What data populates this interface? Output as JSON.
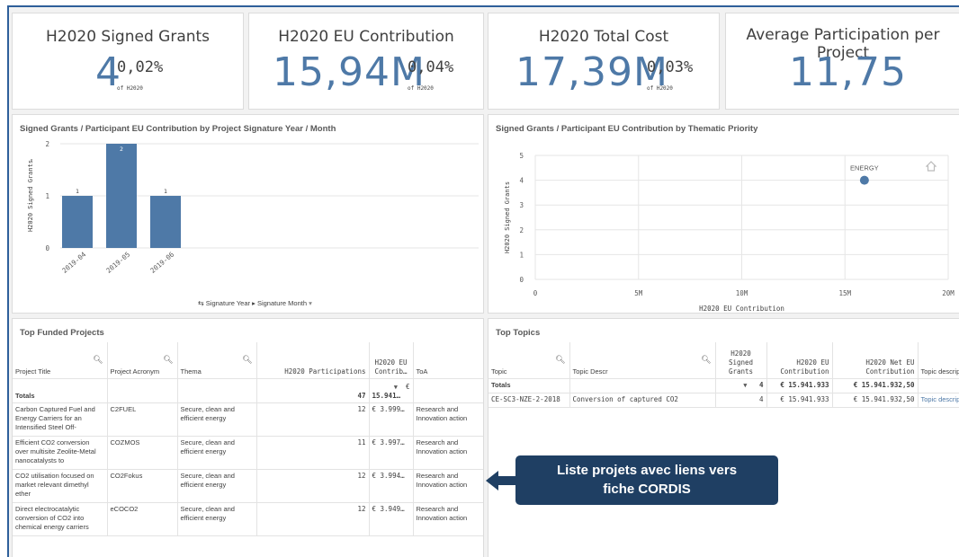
{
  "kpis": [
    {
      "title": "H2020 Signed Grants",
      "main": "4",
      "sub": "0,02%",
      "of": "of H2020"
    },
    {
      "title": "H2020 EU Contribution",
      "main": "15,94M",
      "sub": "0,04%",
      "of": "of H2020"
    },
    {
      "title": "H2020 Total Cost",
      "main": "17,39M",
      "sub": "0,03%",
      "of": "of H2020"
    },
    {
      "title": "Average Participation per Project",
      "main": "11,75",
      "sub": "",
      "of": ""
    }
  ],
  "chart_data": [
    {
      "type": "bar",
      "title": "Signed Grants / Participant EU Contribution by Project Signature Year / Month",
      "categories": [
        "2019-04",
        "2019-05",
        "2019-06"
      ],
      "values": [
        1,
        2,
        1
      ],
      "ylabel": "H2020 Signed Grants",
      "ylim": [
        0,
        2
      ],
      "yticks": [
        "0",
        "1",
        "2"
      ],
      "color": "#4e79a7",
      "drilldown": {
        "level1": "Signature Year",
        "level2": "Signature Month"
      }
    },
    {
      "type": "scatter",
      "title": "Signed Grants / Participant EU Contribution by Thematic Priority",
      "points": [
        {
          "label": "ENERGY",
          "x": 15941933,
          "y": 4
        }
      ],
      "xlabel": "H2020 EU Contribution",
      "ylabel": "H2020 Signed Grants",
      "xlim": [
        0,
        20000000
      ],
      "ylim": [
        0,
        5
      ],
      "xticks": [
        "0",
        "5M",
        "10M",
        "15M",
        "20M"
      ],
      "yticks": [
        "0",
        "1",
        "2",
        "3",
        "4",
        "5"
      ],
      "color": "#4e79a7"
    }
  ],
  "projects": {
    "title": "Top Funded Projects",
    "headers": [
      "Project Title",
      "Project Acronym",
      "Thema",
      "H2020 Participations",
      "H2020 EU Contrib…",
      "ToA"
    ],
    "totals": {
      "label": "Totals",
      "participations": "47",
      "contribution": "15.941…",
      "contribution_prefix": "€"
    },
    "rows": [
      {
        "title": "Carbon Captured Fuel and Energy Carriers for an Intensified Steel Off-",
        "acronym": "C2FUEL",
        "thema": "Secure, clean and efficient energy",
        "participations": "12",
        "contribution": "€ 3.999…",
        "toa": "Research and Innovation action"
      },
      {
        "title": "Efficient CO2 conversion over multisite Zeolite-Metal nanocatalysts to",
        "acronym": "COZMOS",
        "thema": "Secure, clean and efficient energy",
        "participations": "11",
        "contribution": "€ 3.997…",
        "toa": "Research and Innovation action"
      },
      {
        "title": "CO2 utilisation focused on market relevant dimethyl ether",
        "acronym": "CO2Fokus",
        "thema": "Secure, clean and efficient energy",
        "participations": "12",
        "contribution": "€ 3.994…",
        "toa": "Research and Innovation action"
      },
      {
        "title": "Direct electrocatalytic conversion of CO2 into chemical energy carriers",
        "acronym": "eCOCO2",
        "thema": "Secure, clean and efficient energy",
        "participations": "12",
        "contribution": "€ 3.949…",
        "toa": "Research and Innovation action"
      }
    ]
  },
  "topics": {
    "title": "Top Topics",
    "headers": [
      "Topic",
      "Topic Descr",
      "H2020 Signed Grants",
      "H2020 EU Contribution",
      "H2020 Net EU Contribution",
      "Topic description"
    ],
    "totals": {
      "label": "Totals",
      "grants": "4",
      "contribution": "€ 15.941.933",
      "net": "€ 15.941.932,50"
    },
    "rows": [
      {
        "topic": "CE-SC3-NZE-2-2018",
        "descr": "Conversion of captured CO2",
        "grants": "4",
        "contribution": "€ 15.941.933",
        "net": "€ 15.941.932,50",
        "link": "Topic descrip"
      }
    ]
  },
  "callout": {
    "line1": "Liste projets avec liens vers",
    "line2": "fiche CORDIS",
    "color": "#1f3f63"
  },
  "icons": {
    "search": "search-icon",
    "sort": "sort-desc-icon",
    "drill": "drilldown-icon",
    "home": "home-icon"
  }
}
